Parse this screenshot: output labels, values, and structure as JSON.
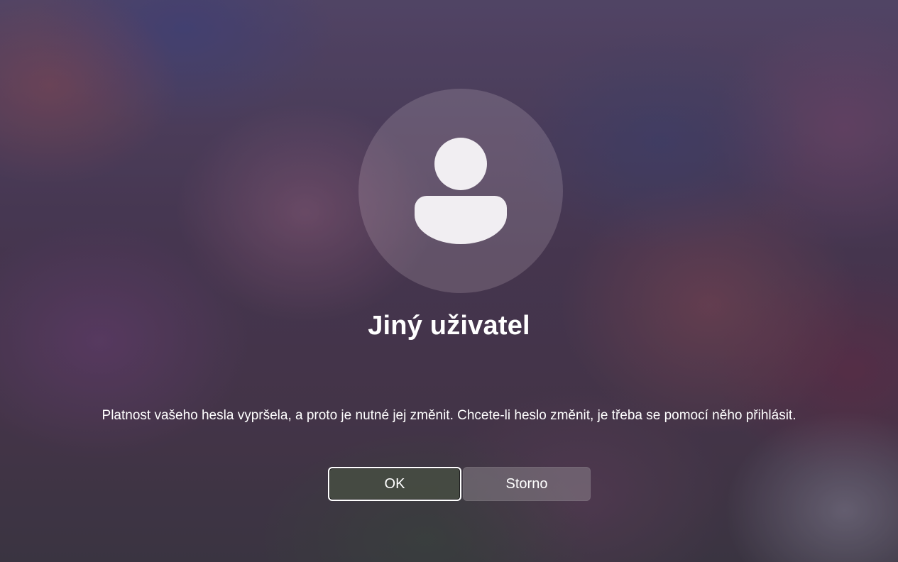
{
  "user": {
    "name": "Jiný uživatel",
    "avatar_icon": "user-silhouette-icon"
  },
  "dialog": {
    "message": "Platnost vašeho hesla vypršela, a proto je nutné jej změnit. Chcete-li heslo změnit, je třeba se pomocí něho přihlásit.",
    "ok_label": "OK",
    "cancel_label": "Storno"
  },
  "colors": {
    "text": "#ffffff",
    "ok_border": "#ffffff",
    "avatar_fill": "#f1eef2"
  }
}
